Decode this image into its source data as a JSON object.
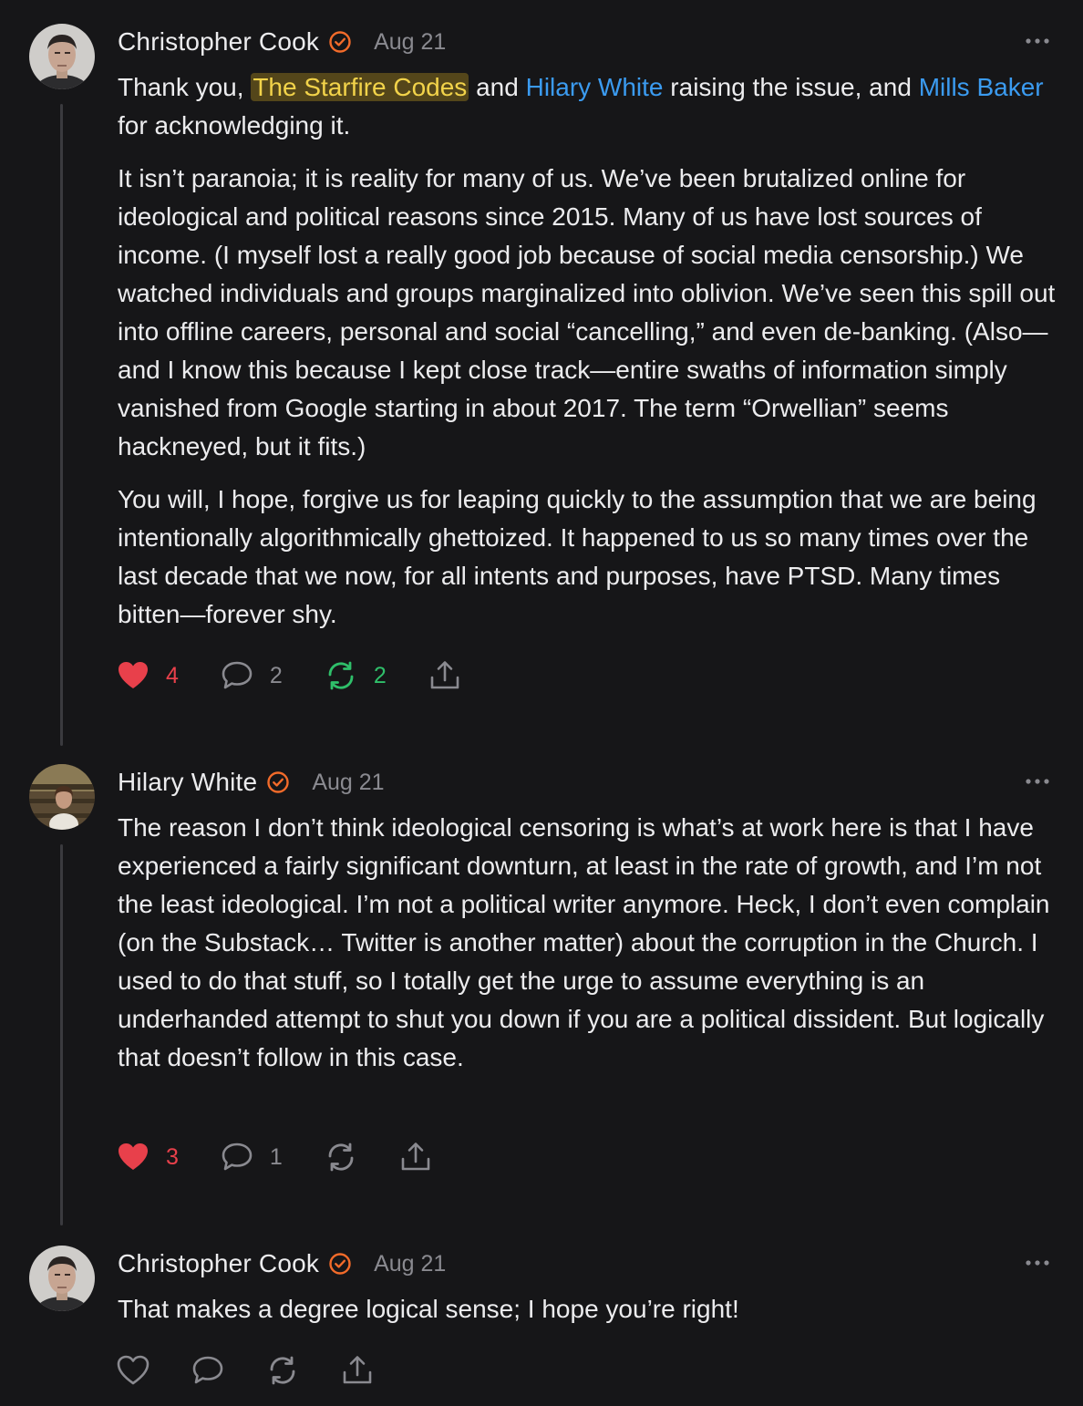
{
  "comments": [
    {
      "author": "Christopher Cook",
      "date": "Aug 21",
      "p1": {
        "t1": "Thank you, ",
        "m1": "The Starfire Codes",
        "t2": " and ",
        "m2": "Hilary White",
        "t3": " raising the issue, and ",
        "m3": "Mills Baker",
        "t4": " for acknowledging it."
      },
      "p2": "It isn’t paranoia; it is reality for many of us. We’ve been brutalized online for ideological and political reasons since 2015. Many of us have lost sources of income. (I myself lost a really good job because of social media censorship.) We watched individuals and groups marginalized into oblivion. We’ve seen this spill out into offline careers, personal and social “cancelling,” and even de-banking. (Also—and I know this because I kept close track—entire swaths of information simply vanished from Google starting in about 2017. The term “Orwellian” seems hackneyed, but it fits.)",
      "p3": "You will, I hope, forgive us for leaping quickly to the assumption that we are being intentionally algorithmically ghettoized. It happened to us so many times over the last decade that we now, for all intents and purposes, have PTSD. Many times bitten—forever shy.",
      "likes": "4",
      "replies": "2",
      "restacks": "2"
    },
    {
      "author": "Hilary White",
      "date": "Aug 21",
      "p1": "The reason I don’t think ideological censoring is what’s at work here is that I have experienced a fairly significant downturn, at least in the rate of growth, and I’m not the least ideological. I’m not a political writer anymore. Heck, I don’t even complain (on the Substack… Twitter is another matter) about the corruption in the Church. I used to do that stuff, so I totally get the urge to assume everything is an underhanded attempt to shut you down if you are a political dissident. But logically that doesn’t follow in this case.",
      "likes": "3",
      "replies": "1"
    },
    {
      "author": "Christopher Cook",
      "date": "Aug 21",
      "p1": "That makes a degree logical sense; I hope you’re right!"
    }
  ],
  "colors": {
    "background": "#161618",
    "text": "#ececee",
    "muted": "#8a8a90",
    "mention": "#3b9bf0",
    "highlight_bg": "#54461a",
    "highlight_text": "#f2d34a",
    "verified": "#f26b2a",
    "like": "#e8404b",
    "restack_active": "#2fbf6a"
  },
  "icons": [
    "heart-icon",
    "comment-bubble-icon",
    "restack-icon",
    "share-icon",
    "verified-badge-icon",
    "more-options-icon"
  ]
}
